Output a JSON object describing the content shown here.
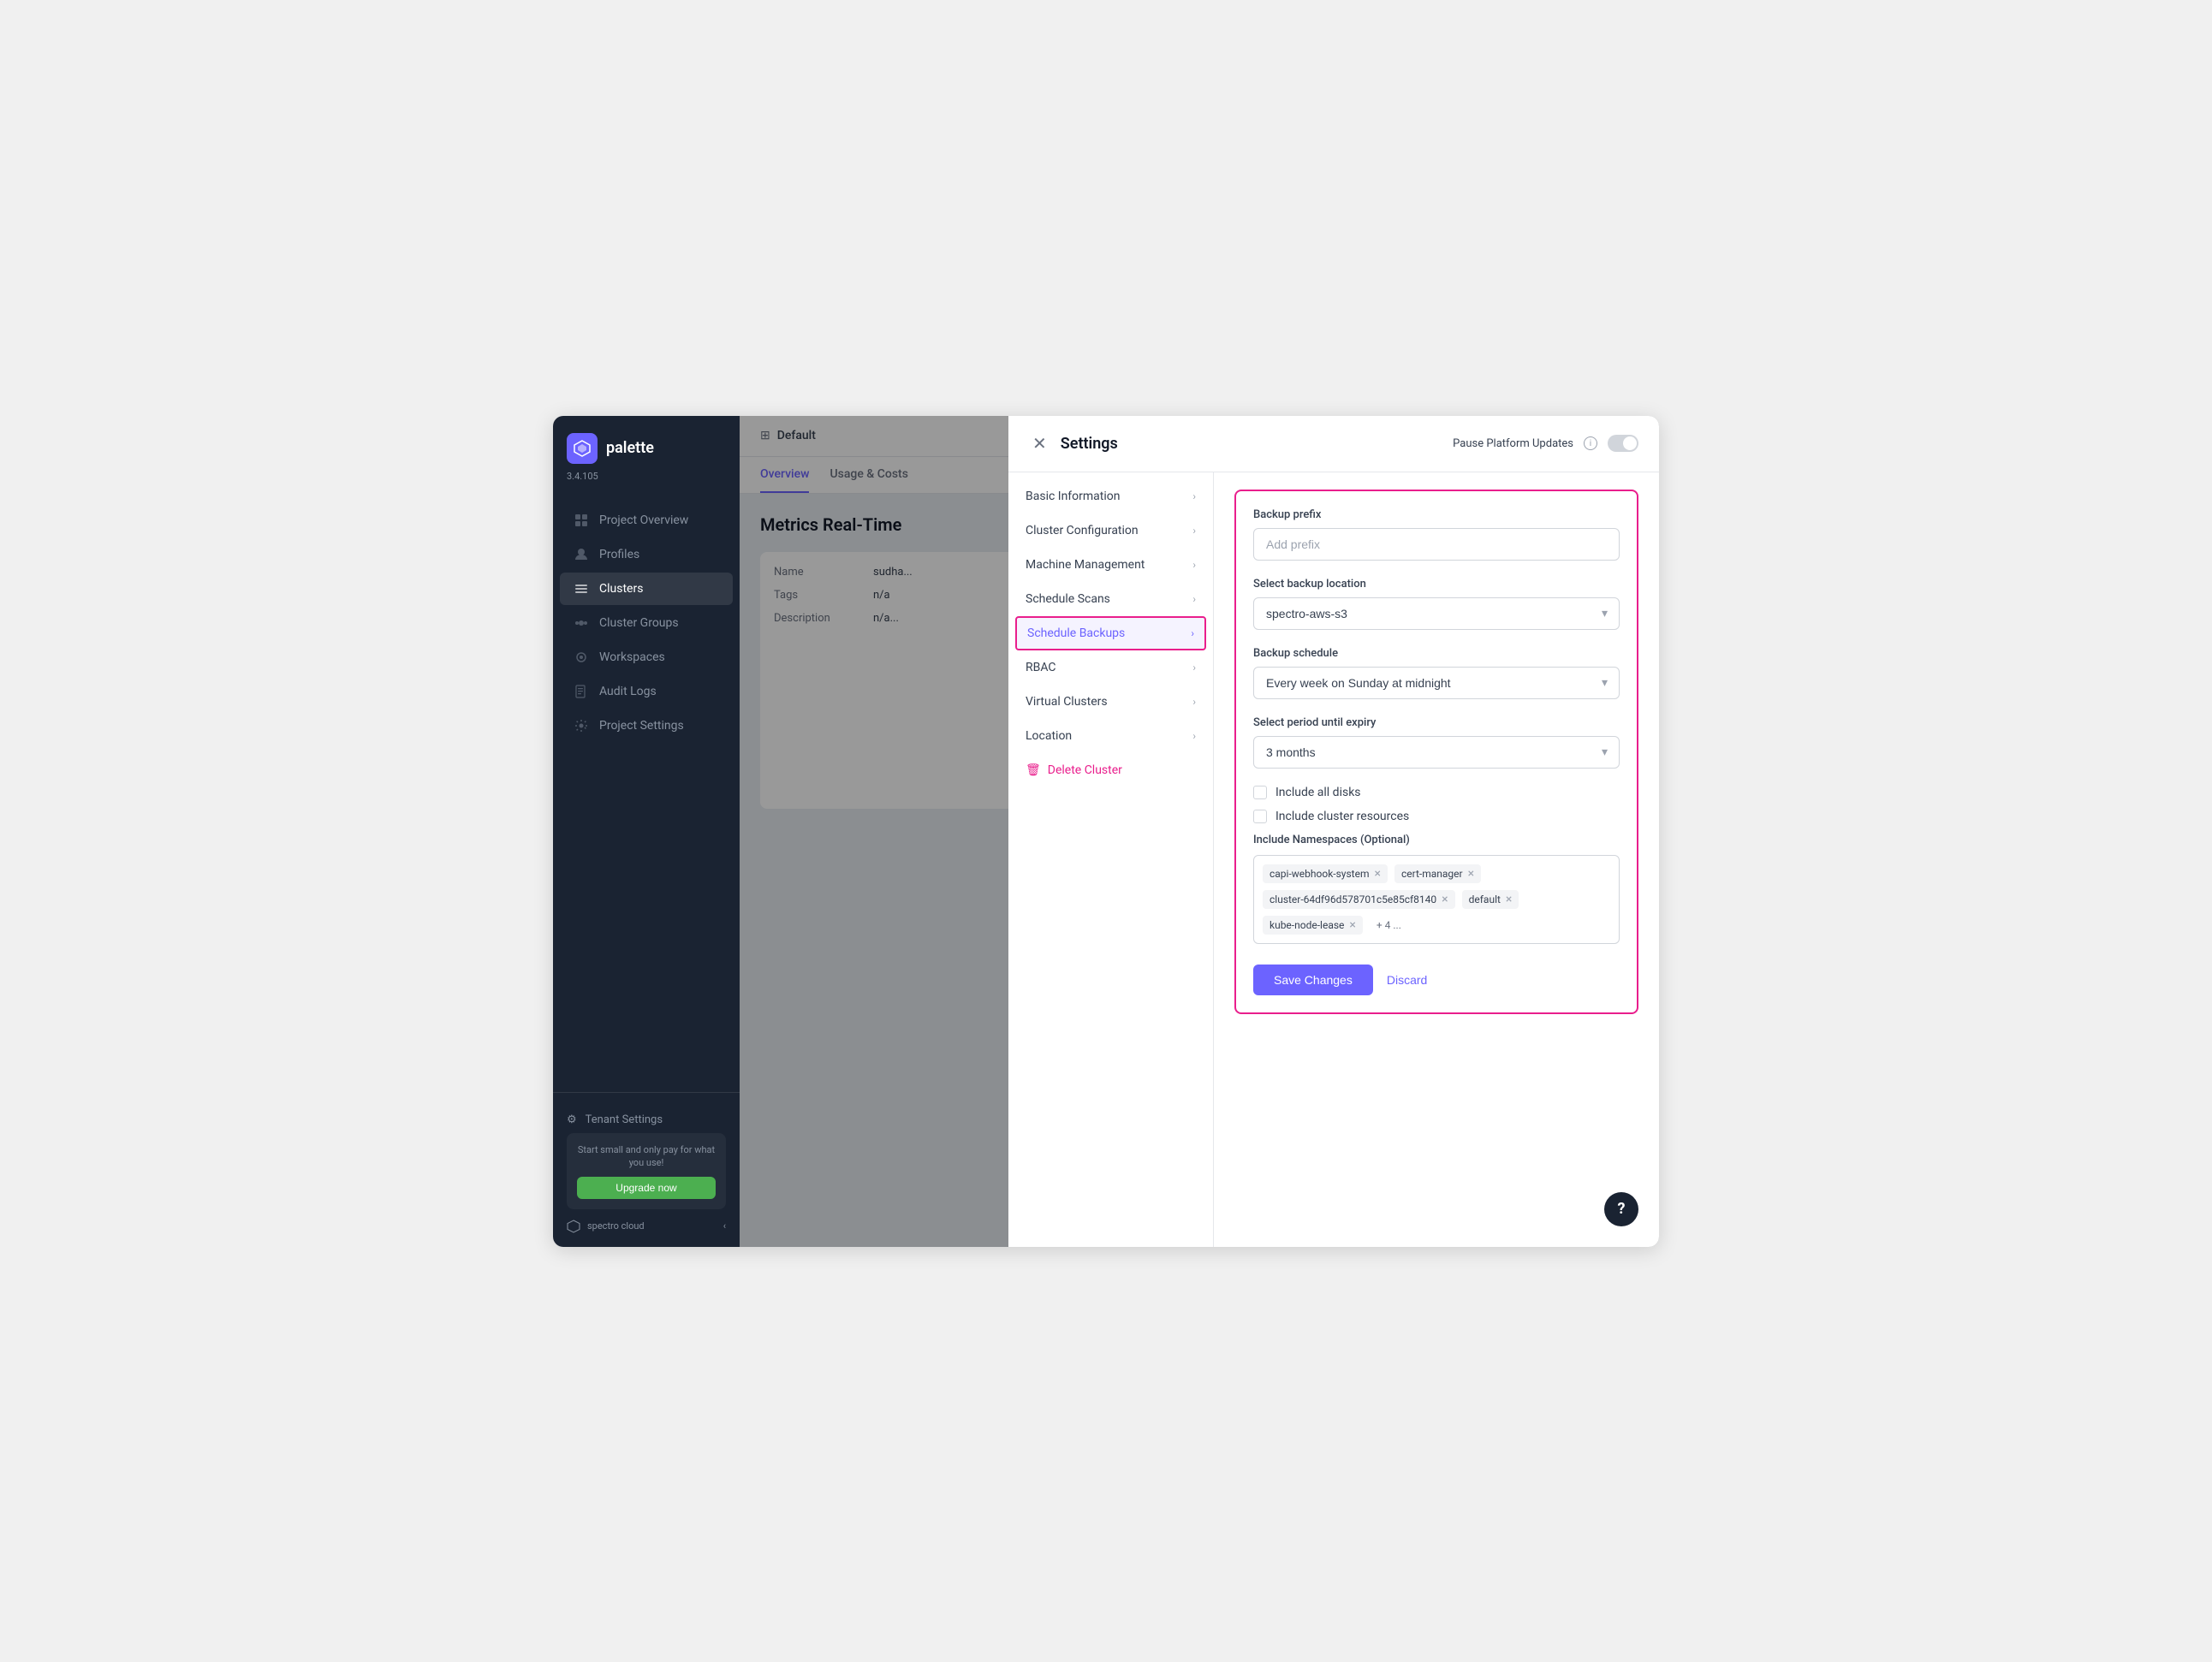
{
  "app": {
    "logo_text": "palette",
    "version": "3.4.105"
  },
  "sidebar": {
    "items": [
      {
        "id": "project-overview",
        "label": "Project Overview",
        "icon": "⊞"
      },
      {
        "id": "profiles",
        "label": "Profiles",
        "icon": "⬡"
      },
      {
        "id": "clusters",
        "label": "Clusters",
        "icon": "≡"
      },
      {
        "id": "cluster-groups",
        "label": "Cluster Groups",
        "icon": "⊕"
      },
      {
        "id": "workspaces",
        "label": "Workspaces",
        "icon": "⚙"
      },
      {
        "id": "audit-logs",
        "label": "Audit Logs",
        "icon": "📋"
      },
      {
        "id": "project-settings",
        "label": "Project Settings",
        "icon": "⚙"
      }
    ],
    "bottom": {
      "tenant": "Tenant Settings",
      "upgrade_text": "Start small and only pay for what you use!",
      "upgrade_btn": "Upgrade now",
      "footer": "spectro cloud"
    }
  },
  "main": {
    "breadcrumb": "Default",
    "tabs": [
      {
        "label": "Overview",
        "active": true
      },
      {
        "label": "Usage & Costs",
        "active": false
      }
    ],
    "page_title": "Metrics Real-Time",
    "rows": [
      {
        "label": "Name",
        "value": "sudha..."
      },
      {
        "label": "Tags",
        "value": "n/a"
      },
      {
        "label": "Description",
        "value": "n/a..."
      }
    ]
  },
  "settings": {
    "title": "Settings",
    "pause_label": "Pause Platform Updates",
    "nav_items": [
      {
        "id": "basic-information",
        "label": "Basic Information",
        "active": false
      },
      {
        "id": "cluster-configuration",
        "label": "Cluster Configuration",
        "active": false
      },
      {
        "id": "machine-management",
        "label": "Machine Management",
        "active": false
      },
      {
        "id": "schedule-scans",
        "label": "Schedule Scans",
        "active": false
      },
      {
        "id": "schedule-backups",
        "label": "Schedule Backups",
        "active": true
      },
      {
        "id": "rbac",
        "label": "RBAC",
        "active": false
      },
      {
        "id": "virtual-clusters",
        "label": "Virtual Clusters",
        "active": false
      },
      {
        "id": "location",
        "label": "Location",
        "active": false
      }
    ],
    "delete_label": "Delete Cluster",
    "content": {
      "backup_prefix_label": "Backup prefix",
      "backup_prefix_placeholder": "Add prefix",
      "backup_location_label": "Select backup location",
      "backup_location_value": "spectro-aws-s3",
      "backup_schedule_label": "Backup schedule",
      "backup_schedule_value": "Every week on Sunday at midnight",
      "expiry_label": "Select period until expiry",
      "expiry_value": "3 months",
      "include_all_disks_label": "Include all disks",
      "include_cluster_resources_label": "Include cluster resources",
      "namespaces_label": "Include Namespaces (Optional)",
      "namespaces": [
        {
          "value": "capi-webhook-system"
        },
        {
          "value": "cert-manager"
        },
        {
          "value": "cluster-64df96d578701c5e85cf8140"
        },
        {
          "value": "default"
        },
        {
          "value": "kube-node-lease"
        }
      ],
      "more_count": "+ 4 ...",
      "save_label": "Save Changes",
      "discard_label": "Discard"
    }
  },
  "help_btn": "?"
}
